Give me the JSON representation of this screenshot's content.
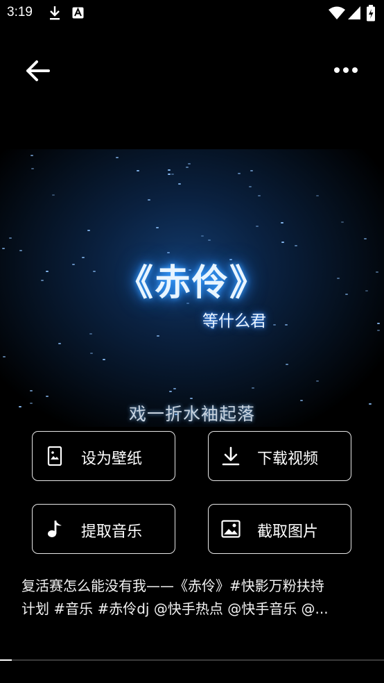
{
  "status_bar": {
    "time": "3:19",
    "icons": [
      "download-icon",
      "a-letter-icon",
      "wifi-icon",
      "signal-icon",
      "battery-icon"
    ]
  },
  "top_bar": {
    "back_icon": "arrow-left-icon",
    "more_icon": "more-dots-icon"
  },
  "video": {
    "title": "《赤伶》",
    "artist": "等什么君",
    "lyric": "戏一折水袖起落"
  },
  "actions": [
    {
      "label": "设为壁纸",
      "icon": "phone-wallpaper-icon"
    },
    {
      "label": "下载视频",
      "icon": "download-icon"
    },
    {
      "label": "提取音乐",
      "icon": "music-note-icon"
    },
    {
      "label": "截取图片",
      "icon": "image-icon"
    }
  ],
  "caption": {
    "line1": "复活赛怎么能没有我——《赤伶》#快影万粉扶持",
    "line2": "计划 #音乐 #赤伶dj @快手热点 @快手音乐 @..."
  },
  "progress": {
    "fraction": 0.03
  },
  "colors": {
    "background": "#000000",
    "glow": "#3aa0ff",
    "button_border": "#e8e8e8"
  }
}
